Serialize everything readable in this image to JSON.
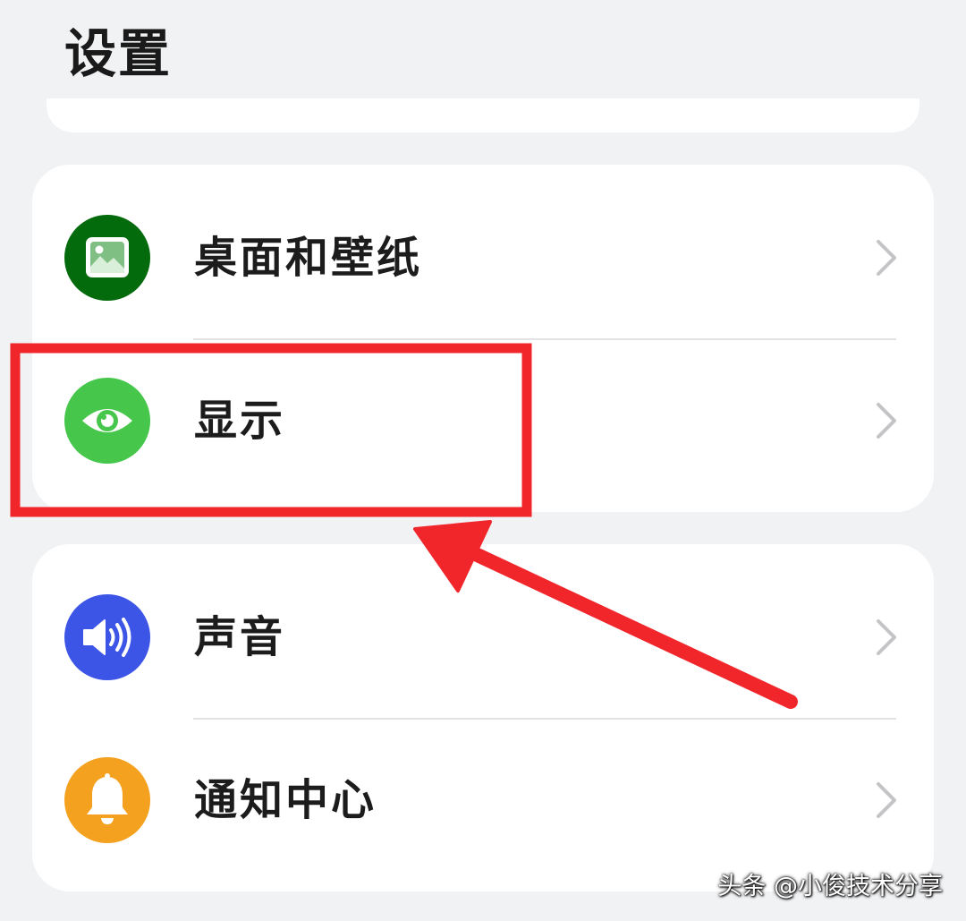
{
  "header": {
    "title": "设置"
  },
  "groups": [
    {
      "items": [
        {
          "label": "桌面和壁纸",
          "icon": "image-icon",
          "color": "#046b0c"
        },
        {
          "label": "显示",
          "icon": "eye-icon",
          "color": "#46c64a"
        }
      ]
    },
    {
      "items": [
        {
          "label": "声音",
          "icon": "speaker-icon",
          "color": "#3c55e6"
        },
        {
          "label": "通知中心",
          "icon": "bell-icon",
          "color": "#f4a11f"
        }
      ]
    }
  ],
  "annotation": {
    "highlight_target": "显示",
    "color": "#f0262b"
  },
  "watermark": {
    "text": "头条 @小俊技术分享"
  }
}
